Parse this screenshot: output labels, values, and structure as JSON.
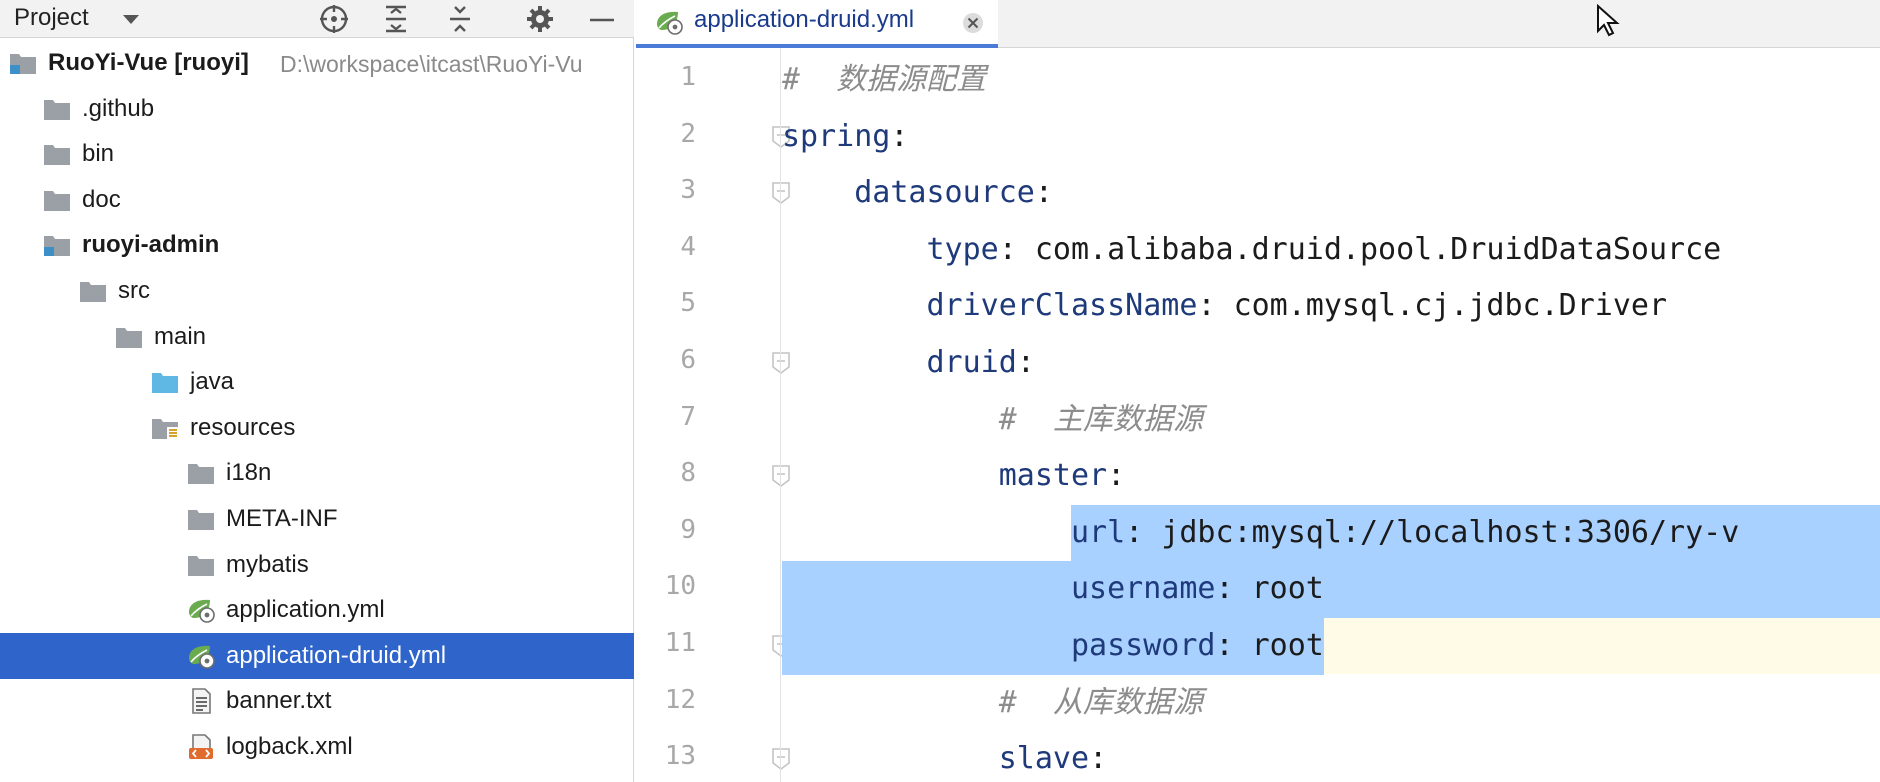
{
  "project_panel": {
    "title": "Project",
    "tree": [
      {
        "label": "RuoYi-Vue [ruoyi]",
        "path": "D:\\workspace\\itcast\\RuoYi-Vu",
        "bold": true,
        "icon": "module-icon",
        "indent": 0,
        "chevron": "none"
      },
      {
        "label": ".github",
        "icon": "folder-icon",
        "indent": 1,
        "chevron": "right"
      },
      {
        "label": "bin",
        "icon": "folder-icon",
        "indent": 1,
        "chevron": "right"
      },
      {
        "label": "doc",
        "icon": "folder-icon",
        "indent": 1,
        "chevron": "right"
      },
      {
        "label": "ruoyi-admin",
        "bold": true,
        "icon": "module-icon",
        "indent": 1,
        "chevron": "down"
      },
      {
        "label": "src",
        "icon": "folder-icon",
        "indent": 2,
        "chevron": "down"
      },
      {
        "label": "main",
        "icon": "folder-icon",
        "indent": 3,
        "chevron": "down"
      },
      {
        "label": "java",
        "icon": "source-folder-icon",
        "indent": 4,
        "chevron": "right"
      },
      {
        "label": "resources",
        "icon": "resources-folder-icon",
        "indent": 4,
        "chevron": "down"
      },
      {
        "label": "i18n",
        "icon": "folder-icon",
        "indent": 5,
        "chevron": "right"
      },
      {
        "label": "META-INF",
        "icon": "folder-icon",
        "indent": 5,
        "chevron": "right"
      },
      {
        "label": "mybatis",
        "icon": "folder-icon",
        "indent": 5,
        "chevron": "right"
      },
      {
        "label": "application.yml",
        "icon": "spring-yml-icon",
        "indent": 5,
        "chevron": "none"
      },
      {
        "label": "application-druid.yml",
        "icon": "spring-yml-icon",
        "indent": 5,
        "chevron": "none",
        "selected": true
      },
      {
        "label": "banner.txt",
        "icon": "text-file-icon",
        "indent": 5,
        "chevron": "none"
      },
      {
        "label": "logback.xml",
        "icon": "xml-file-icon",
        "indent": 5,
        "chevron": "none"
      }
    ]
  },
  "editor": {
    "tab": {
      "label": "application-druid.yml"
    },
    "lines": [
      {
        "n": "1",
        "tokens": [
          {
            "t": "#  数据源配置",
            "c": "c"
          }
        ]
      },
      {
        "n": "2",
        "tokens": [
          {
            "t": "spring",
            "c": "k"
          },
          {
            "t": ":",
            "c": "p"
          }
        ]
      },
      {
        "n": "3",
        "tokens": [
          {
            "t": "    ",
            "c": "p"
          },
          {
            "t": "datasource",
            "c": "k"
          },
          {
            "t": ":",
            "c": "p"
          }
        ]
      },
      {
        "n": "4",
        "tokens": [
          {
            "t": "        ",
            "c": "p"
          },
          {
            "t": "type",
            "c": "k"
          },
          {
            "t": ": ",
            "c": "p"
          },
          {
            "t": "com.alibaba.druid.pool.DruidDataSource",
            "c": "v"
          }
        ]
      },
      {
        "n": "5",
        "tokens": [
          {
            "t": "        ",
            "c": "p"
          },
          {
            "t": "driverClassName",
            "c": "k"
          },
          {
            "t": ": ",
            "c": "p"
          },
          {
            "t": "com.mysql.cj.jdbc.Driver",
            "c": "v"
          }
        ]
      },
      {
        "n": "6",
        "tokens": [
          {
            "t": "        ",
            "c": "p"
          },
          {
            "t": "druid",
            "c": "k"
          },
          {
            "t": ":",
            "c": "p"
          }
        ]
      },
      {
        "n": "7",
        "tokens": [
          {
            "t": "            ",
            "c": "p"
          },
          {
            "t": "#  主库数据源",
            "c": "c"
          }
        ]
      },
      {
        "n": "8",
        "tokens": [
          {
            "t": "            ",
            "c": "p"
          },
          {
            "t": "master",
            "c": "k"
          },
          {
            "t": ":",
            "c": "p"
          }
        ]
      },
      {
        "n": "9",
        "tokens": [
          {
            "t": "                ",
            "c": "p"
          },
          {
            "t": "url",
            "c": "k"
          },
          {
            "t": ": ",
            "c": "p"
          },
          {
            "t": "jdbc:mysql://localhost:3306/ry-v",
            "c": "v"
          }
        ]
      },
      {
        "n": "10",
        "tokens": [
          {
            "t": "                ",
            "c": "p"
          },
          {
            "t": "username",
            "c": "k"
          },
          {
            "t": ": ",
            "c": "p"
          },
          {
            "t": "root",
            "c": "v"
          }
        ]
      },
      {
        "n": "11",
        "tokens": [
          {
            "t": "                ",
            "c": "p"
          },
          {
            "t": "password",
            "c": "k"
          },
          {
            "t": ": ",
            "c": "p"
          },
          {
            "t": "root",
            "c": "v"
          }
        ]
      },
      {
        "n": "12",
        "tokens": [
          {
            "t": "            ",
            "c": "p"
          },
          {
            "t": "#  从库数据源",
            "c": "c"
          }
        ]
      },
      {
        "n": "13",
        "tokens": [
          {
            "t": "            ",
            "c": "p"
          },
          {
            "t": "slave",
            "c": "k"
          },
          {
            "t": ":",
            "c": "p"
          }
        ]
      }
    ],
    "folds": [
      2,
      3,
      6,
      8,
      11,
      13
    ],
    "current_line": 11,
    "selection": {
      "from_line": 9,
      "to_line": 11
    }
  },
  "colors": {
    "selected_row": "#2f65ca",
    "selection": "#a9d1ff",
    "current_line": "#fffbe6",
    "yaml_key": "#1f3a7a",
    "comment": "#8c8c8c",
    "tab_underline": "#4a7bd6"
  }
}
